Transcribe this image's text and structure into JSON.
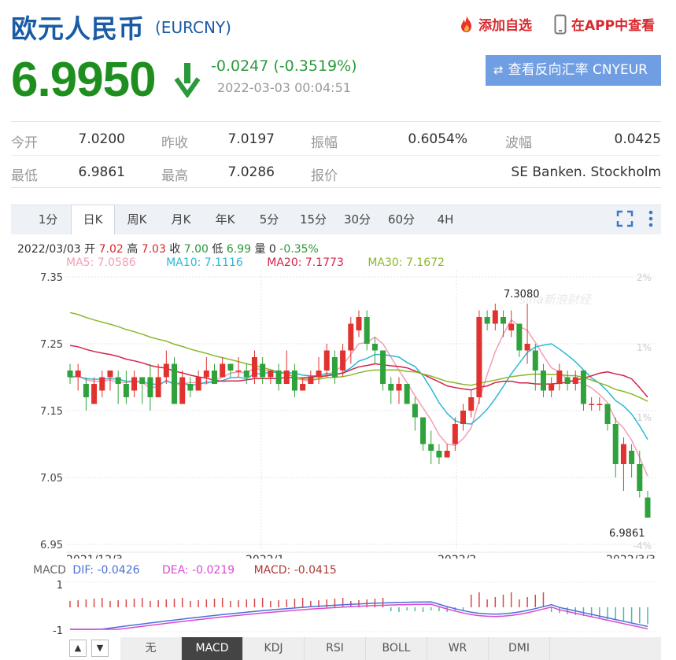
{
  "header": {
    "title": "欧元人民币",
    "code": "(EURCNY)",
    "fav_label": "添加自选",
    "app_label": "在APP中查看"
  },
  "quote": {
    "price": "6.9950",
    "change": "-0.0247 (-0.3519%)",
    "time": "2022-03-03 00:04:51",
    "reverse_button": "查看反向汇率 CNYEUR",
    "price_color": "#1e8f1e"
  },
  "stats": [
    {
      "label": "今开",
      "value": "7.0200"
    },
    {
      "label": "昨收",
      "value": "7.0197"
    },
    {
      "label": "振幅",
      "value": "0.6054%"
    },
    {
      "label": "波幅",
      "value": "0.0425"
    },
    {
      "label": "最低",
      "value": "6.9861"
    },
    {
      "label": "最高",
      "value": "7.0286"
    },
    {
      "label": "报价",
      "value": ""
    },
    {
      "label": "",
      "value": "SE Banken. Stockholm"
    }
  ],
  "period_tabs": [
    "1分",
    "日K",
    "周K",
    "月K",
    "年K",
    "5分",
    "15分",
    "30分",
    "60分",
    "4H"
  ],
  "active_tab": "日K",
  "info": {
    "date": "2022/03/03",
    "open_label": "开",
    "open": "7.02",
    "high_label": "高",
    "high": "7.03",
    "close_label": "收",
    "close": "7.00",
    "low_label": "低",
    "low": "6.99",
    "vol_label": "量",
    "vol": "0",
    "pct": "-0.35%"
  },
  "ma_legend": [
    {
      "text": "MA5: 7.0586",
      "color": "#f29fb4"
    },
    {
      "text": "MA10: 7.1116",
      "color": "#29b8d6"
    },
    {
      "text": "MA20: 7.1773",
      "color": "#d4234b"
    },
    {
      "text": "MA30: 7.1672",
      "color": "#8ab82a"
    }
  ],
  "watermark": "sina新浪财经",
  "chart_data": {
    "type": "candlestick",
    "y_ticks": [
      "7.35",
      "7.25",
      "7.15",
      "7.05",
      "6.95"
    ],
    "y_ticks_values": [
      7.35,
      7.25,
      7.15,
      7.05,
      6.95
    ],
    "pct_ticks": [
      "2%",
      "1%",
      "-1%",
      "-4%"
    ],
    "x_labels": [
      "2021/12/3",
      "2022/1",
      "2022/2",
      "2022/3/3"
    ],
    "ylim": [
      6.95,
      7.35
    ],
    "high_label": "7.3080",
    "low_label": "6.9861",
    "candles": [
      [
        7.21,
        7.2,
        7.22,
        7.19
      ],
      [
        7.2,
        7.21,
        7.22,
        7.18
      ],
      [
        7.19,
        7.17,
        7.2,
        7.15
      ],
      [
        7.16,
        7.19,
        7.2,
        7.16
      ],
      [
        7.18,
        7.2,
        7.21,
        7.17
      ],
      [
        7.2,
        7.21,
        7.21,
        7.18
      ],
      [
        7.2,
        7.19,
        7.21,
        7.16
      ],
      [
        7.19,
        7.17,
        7.21,
        7.16
      ],
      [
        7.18,
        7.2,
        7.21,
        7.17
      ],
      [
        7.2,
        7.19,
        7.2,
        7.16
      ],
      [
        7.2,
        7.17,
        7.22,
        7.15
      ],
      [
        7.17,
        7.2,
        7.22,
        7.17
      ],
      [
        7.2,
        7.22,
        7.24,
        7.19
      ],
      [
        7.22,
        7.16,
        7.23,
        7.16
      ],
      [
        7.16,
        7.2,
        7.21,
        7.16
      ],
      [
        7.19,
        7.18,
        7.2,
        7.17
      ],
      [
        7.18,
        7.2,
        7.21,
        7.18
      ],
      [
        7.2,
        7.21,
        7.23,
        7.19
      ],
      [
        7.21,
        7.19,
        7.22,
        7.19
      ],
      [
        7.2,
        7.22,
        7.23,
        7.2
      ],
      [
        7.22,
        7.21,
        7.22,
        7.2
      ],
      [
        7.21,
        7.21,
        7.23,
        7.2
      ],
      [
        7.21,
        7.2,
        7.22,
        7.19
      ],
      [
        7.2,
        7.23,
        7.24,
        7.19
      ],
      [
        7.22,
        7.2,
        7.23,
        7.19
      ],
      [
        7.2,
        7.21,
        7.21,
        7.19
      ],
      [
        7.21,
        7.19,
        7.22,
        7.18
      ],
      [
        7.19,
        7.21,
        7.24,
        7.19
      ],
      [
        7.21,
        7.18,
        7.22,
        7.17
      ],
      [
        7.18,
        7.19,
        7.2,
        7.18
      ],
      [
        7.19,
        7.2,
        7.21,
        7.19
      ],
      [
        7.2,
        7.21,
        7.23,
        7.19
      ],
      [
        7.21,
        7.24,
        7.25,
        7.2
      ],
      [
        7.23,
        7.2,
        7.24,
        7.19
      ],
      [
        7.21,
        7.24,
        7.25,
        7.2
      ],
      [
        7.24,
        7.28,
        7.29,
        7.22
      ],
      [
        7.27,
        7.29,
        7.3,
        7.26
      ],
      [
        7.29,
        7.25,
        7.3,
        7.24
      ],
      [
        7.25,
        7.24,
        7.26,
        7.22
      ],
      [
        7.24,
        7.19,
        7.24,
        7.18
      ],
      [
        7.19,
        7.18,
        7.2,
        7.16
      ],
      [
        7.18,
        7.19,
        7.2,
        7.16
      ],
      [
        7.19,
        7.16,
        7.19,
        7.16
      ],
      [
        7.16,
        7.14,
        7.17,
        7.12
      ],
      [
        7.14,
        7.1,
        7.14,
        7.09
      ],
      [
        7.1,
        7.09,
        7.12,
        7.07
      ],
      [
        7.09,
        7.08,
        7.1,
        7.07
      ],
      [
        7.08,
        7.09,
        7.1,
        7.08
      ],
      [
        7.1,
        7.13,
        7.14,
        7.09
      ],
      [
        7.13,
        7.15,
        7.16,
        7.12
      ],
      [
        7.15,
        7.17,
        7.18,
        7.14
      ],
      [
        7.17,
        7.29,
        7.3,
        7.16
      ],
      [
        7.29,
        7.28,
        7.3,
        7.27
      ],
      [
        7.28,
        7.3,
        7.31,
        7.27
      ],
      [
        7.29,
        7.28,
        7.3,
        7.26
      ],
      [
        7.27,
        7.28,
        7.3,
        7.26
      ],
      [
        7.28,
        7.24,
        7.28,
        7.23
      ],
      [
        7.24,
        7.25,
        7.31,
        7.22
      ],
      [
        7.24,
        7.21,
        7.25,
        7.18
      ],
      [
        7.21,
        7.18,
        7.22,
        7.17
      ],
      [
        7.18,
        7.19,
        7.2,
        7.17
      ],
      [
        7.19,
        7.21,
        7.22,
        7.18
      ],
      [
        7.2,
        7.19,
        7.21,
        7.18
      ],
      [
        7.19,
        7.2,
        7.21,
        7.18
      ],
      [
        7.21,
        7.16,
        7.21,
        7.15
      ],
      [
        7.16,
        7.16,
        7.17,
        7.15
      ],
      [
        7.16,
        7.16,
        7.17,
        7.15
      ],
      [
        7.16,
        7.13,
        7.16,
        7.12
      ],
      [
        7.13,
        7.07,
        7.14,
        7.05
      ],
      [
        7.07,
        7.1,
        7.11,
        7.03
      ],
      [
        7.09,
        7.07,
        7.1,
        7.05
      ],
      [
        7.07,
        7.03,
        7.09,
        7.02
      ],
      [
        7.02,
        6.99,
        7.03,
        6.99
      ]
    ]
  },
  "macd": {
    "label": "MACD",
    "dif": "DIF: -0.0426",
    "dea": "DEA: -0.0219",
    "macd": "MACD: -0.0415",
    "y_top": "1",
    "y_bottom": "-1"
  },
  "indicator_tabs": [
    "无",
    "MACD",
    "KDJ",
    "RSI",
    "BOLL",
    "WR",
    "DMI"
  ],
  "active_indicator": "MACD"
}
